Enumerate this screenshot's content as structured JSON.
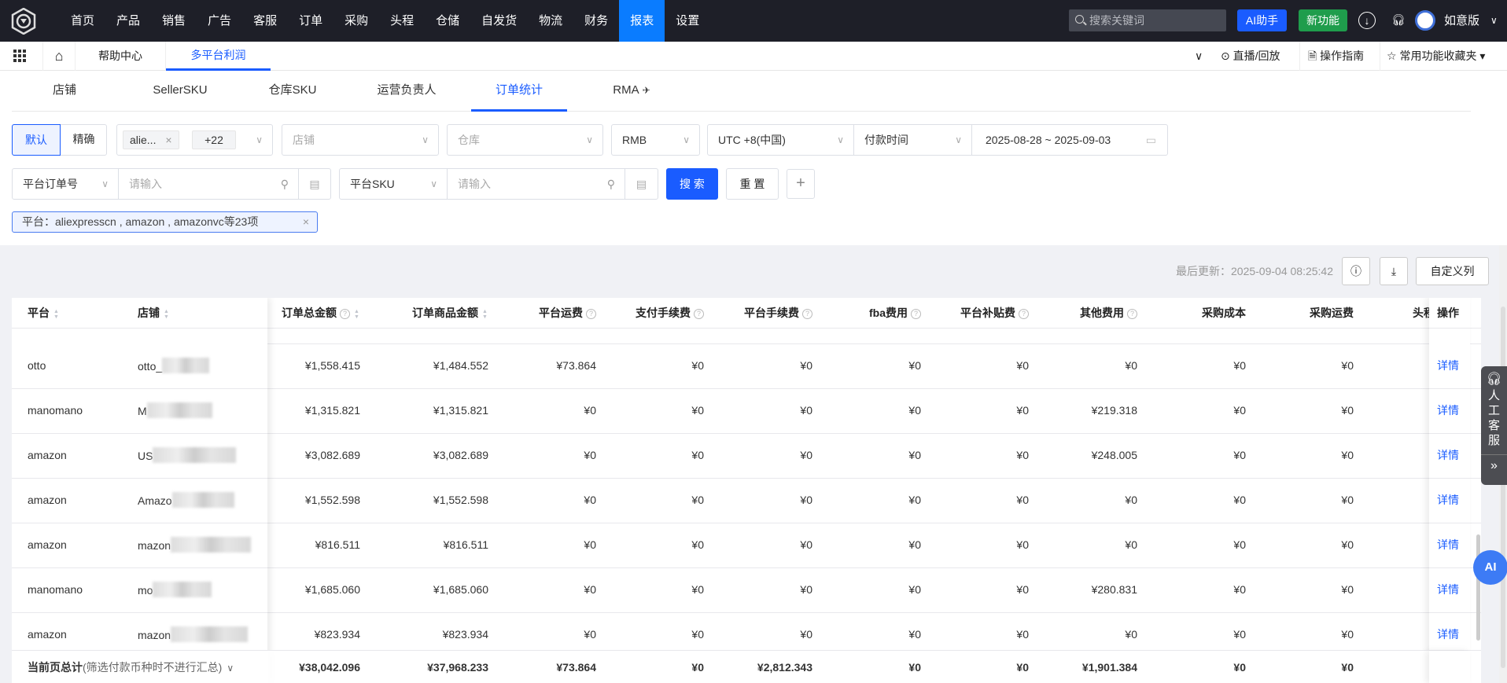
{
  "topnav": {
    "items": [
      "首页",
      "产品",
      "销售",
      "广告",
      "客服",
      "订单",
      "采购",
      "头程",
      "仓储",
      "自发货",
      "物流",
      "财务",
      "报表",
      "设置"
    ],
    "active": "报表",
    "search_placeholder": "搜索关键词",
    "ai_button": "AI助手",
    "new_button": "新功能",
    "user": "如意版"
  },
  "bar2": {
    "help_tab": "帮助中心",
    "active_tab": "多平台利润",
    "live": "直播/回放",
    "guide": "操作指南",
    "favorites": "常用功能收藏夹"
  },
  "subtabs": [
    "店铺",
    "SellerSKU",
    "仓库SKU",
    "运营负责人",
    "订单统计",
    "RMA"
  ],
  "subtab_active": "订单统计",
  "filters": {
    "mode_default": "默认",
    "mode_exact": "精确",
    "platform_tag": "alie...",
    "platform_more": "+22",
    "store_placeholder": "店铺",
    "warehouse_placeholder": "仓库",
    "currency": "RMB",
    "timezone": "UTC +8(中国)",
    "time_type": "付款时间",
    "date_start": "2025-08-28",
    "date_sep": "~",
    "date_end": "2025-09-03",
    "order_no_type": "平台订单号",
    "order_no_placeholder": "请输入",
    "sku_type": "平台SKU",
    "sku_placeholder": "请输入",
    "search": "搜 索",
    "reset": "重 置",
    "add": "+"
  },
  "chip": {
    "label": "平台：",
    "value": "aliexpresscn , amazon , amazonvc等23项"
  },
  "toolbar": {
    "last_update_label": "最后更新：",
    "last_update": "2025-09-04 08:25:42",
    "custom_columns": "自定义列"
  },
  "table": {
    "headers": [
      {
        "label": "平台",
        "sort": true
      },
      {
        "label": "店铺",
        "sort": true
      },
      {
        "label": "订单总金额",
        "help": true,
        "sort": true
      },
      {
        "label": "订单商品金额",
        "sort": true
      },
      {
        "label": "平台运费",
        "help": true
      },
      {
        "label": "支付手续费",
        "help": true
      },
      {
        "label": "平台手续费",
        "help": true
      },
      {
        "label": "fba费用",
        "help": true
      },
      {
        "label": "平台补贴费",
        "help": true
      },
      {
        "label": "其他费用",
        "help": true
      },
      {
        "label": "采购成本"
      },
      {
        "label": "采购运费"
      },
      {
        "label": "头程"
      }
    ],
    "action_header": "操作",
    "action_label": "详情",
    "rows": [
      {
        "platform": "otto",
        "store": "otto_",
        "values": [
          "¥1,558.415",
          "¥1,484.552",
          "¥73.864",
          "¥0",
          "¥0",
          "¥0",
          "¥0",
          "¥0",
          "¥0",
          "¥0"
        ]
      },
      {
        "platform": "manomano",
        "store": "M",
        "values": [
          "¥1,315.821",
          "¥1,315.821",
          "¥0",
          "¥0",
          "¥0",
          "¥0",
          "¥0",
          "¥219.318",
          "¥0",
          "¥0"
        ]
      },
      {
        "platform": "amazon",
        "store": "US",
        "values": [
          "¥3,082.689",
          "¥3,082.689",
          "¥0",
          "¥0",
          "¥0",
          "¥0",
          "¥0",
          "¥248.005",
          "¥0",
          "¥0"
        ]
      },
      {
        "platform": "amazon",
        "store": "Amazo",
        "values": [
          "¥1,552.598",
          "¥1,552.598",
          "¥0",
          "¥0",
          "¥0",
          "¥0",
          "¥0",
          "¥0",
          "¥0",
          "¥0"
        ]
      },
      {
        "platform": "amazon",
        "store": "mazon",
        "values": [
          "¥816.511",
          "¥816.511",
          "¥0",
          "¥0",
          "¥0",
          "¥0",
          "¥0",
          "¥0",
          "¥0",
          "¥0"
        ]
      },
      {
        "platform": "manomano",
        "store": "mo",
        "values": [
          "¥1,685.060",
          "¥1,685.060",
          "¥0",
          "¥0",
          "¥0",
          "¥0",
          "¥0",
          "¥280.831",
          "¥0",
          "¥0"
        ]
      },
      {
        "platform": "amazon",
        "store": "mazon",
        "values": [
          "¥823.934",
          "¥823.934",
          "¥0",
          "¥0",
          "¥0",
          "¥0",
          "¥0",
          "¥0",
          "¥0",
          "¥0"
        ]
      }
    ],
    "total": {
      "label": "当前页总计",
      "note": "(筛选付款币种时不进行汇总)",
      "values": [
        "¥38,042.096",
        "¥37,968.233",
        "¥73.864",
        "¥0",
        "¥2,812.343",
        "¥0",
        "¥0",
        "¥1,901.384",
        "¥0",
        "¥0"
      ]
    }
  },
  "float": {
    "kefu": "人工客服",
    "ai": "AI"
  },
  "colors": {
    "accent": "#1a5cff",
    "nav_bg": "#1e1f28",
    "nav_active": "#0a7cff",
    "new_green": "#1f9d4c"
  }
}
